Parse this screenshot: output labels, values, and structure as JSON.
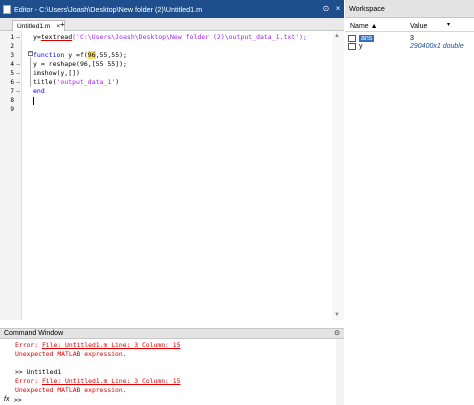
{
  "editor": {
    "title": "Editor - C:\\Users\\Joash\\Desktop\\New folder (2)\\Untitled1.m",
    "tab_label": "Untitled1.m",
    "tab_close": "×",
    "tab_add": "+",
    "controls": {
      "pin": "⊙",
      "close": "×"
    },
    "line_numbers": [
      "1",
      "2",
      "3",
      "4",
      "5",
      "6",
      "7",
      "8",
      "9"
    ],
    "dash": "—",
    "code_lines": [
      [
        {
          "t": "y=",
          "c": ""
        },
        {
          "t": "textread",
          "c": "ul"
        },
        {
          "t": "('C:\\Users\\Joash\\Desktop\\New folder (2)\\output_data_1.txt');",
          "c": "str"
        }
      ],
      [],
      [
        {
          "t": "function",
          "c": "kw"
        },
        {
          "t": " y =f(",
          "c": ""
        },
        {
          "t": "96",
          "c": "hl"
        },
        {
          "t": ",55,55);",
          "c": ""
        }
      ],
      [
        {
          "t": "y = reshape(96,[55 55]);",
          "c": ""
        }
      ],
      [
        {
          "t": "imshow(y,[])",
          "c": ""
        }
      ],
      [
        {
          "t": "title(",
          "c": ""
        },
        {
          "t": "'output_data_1'",
          "c": "str"
        },
        {
          "t": ")",
          "c": ""
        }
      ],
      [
        {
          "t": "end",
          "c": "kw"
        }
      ],
      [],
      []
    ],
    "fold_symbol": "−",
    "scroll_up": "▲",
    "scroll_down": "▼"
  },
  "workspace": {
    "title": "Workspace",
    "col_name": "Name ▲",
    "col_value": "Value",
    "sort_icon": "▾",
    "variables": [
      {
        "name": "ans",
        "value": "3"
      },
      {
        "name": "y",
        "value": "290400x1 double"
      }
    ]
  },
  "command_window": {
    "title": "Command Window",
    "control": "⊙",
    "lines": [
      {
        "type": "err",
        "prefix": "Error: ",
        "link": "File: Untitled1.m Line: 3 Column: 15"
      },
      {
        "type": "plain_err",
        "text": "Unexpected MATLAB expression."
      },
      {
        "type": "blank",
        "text": ""
      },
      {
        "type": "plain",
        "text": ">> Untitled1"
      },
      {
        "type": "err",
        "prefix": "Error: ",
        "link": "File: Untitled1.m Line: 3 Column: 15"
      },
      {
        "type": "plain_err",
        "text": "Unexpected MATLAB expression."
      }
    ],
    "fx": "fx",
    "prompt": ">>"
  }
}
